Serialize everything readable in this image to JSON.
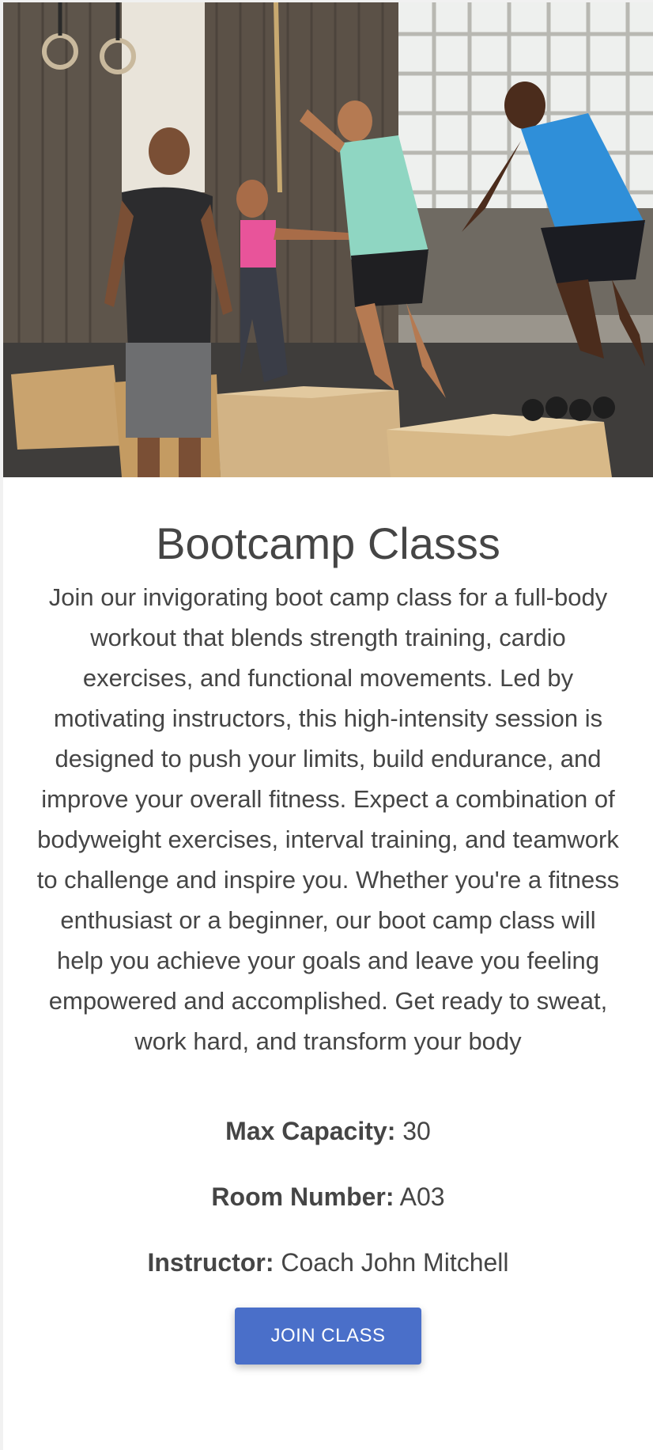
{
  "hero": {
    "image": "bootcamp-class-photo"
  },
  "class": {
    "title": "Bootcamp Classs",
    "description": "Join our invigorating boot camp class for a full-body workout that blends strength training, cardio exercises, and functional movements. Led by motivating instructors, this high-intensity session is designed to push your limits, build endurance, and improve your overall fitness. Expect a combination of bodyweight exercises, interval training, and teamwork to challenge and inspire you. Whether you're a fitness enthusiast or a beginner, our boot camp class will help you achieve your goals and leave you feeling empowered and accomplished. Get ready to sweat, work hard, and transform your body"
  },
  "details": {
    "capacity_label": "Max Capacity:",
    "capacity_value": "30",
    "room_label": "Room Number:",
    "room_value": "A03",
    "instructor_label": "Instructor:",
    "instructor_value": "Coach John Mitchell"
  },
  "actions": {
    "join_label": "JOIN CLASS"
  },
  "colors": {
    "button": "#4a6fc9",
    "text": "#454545"
  }
}
